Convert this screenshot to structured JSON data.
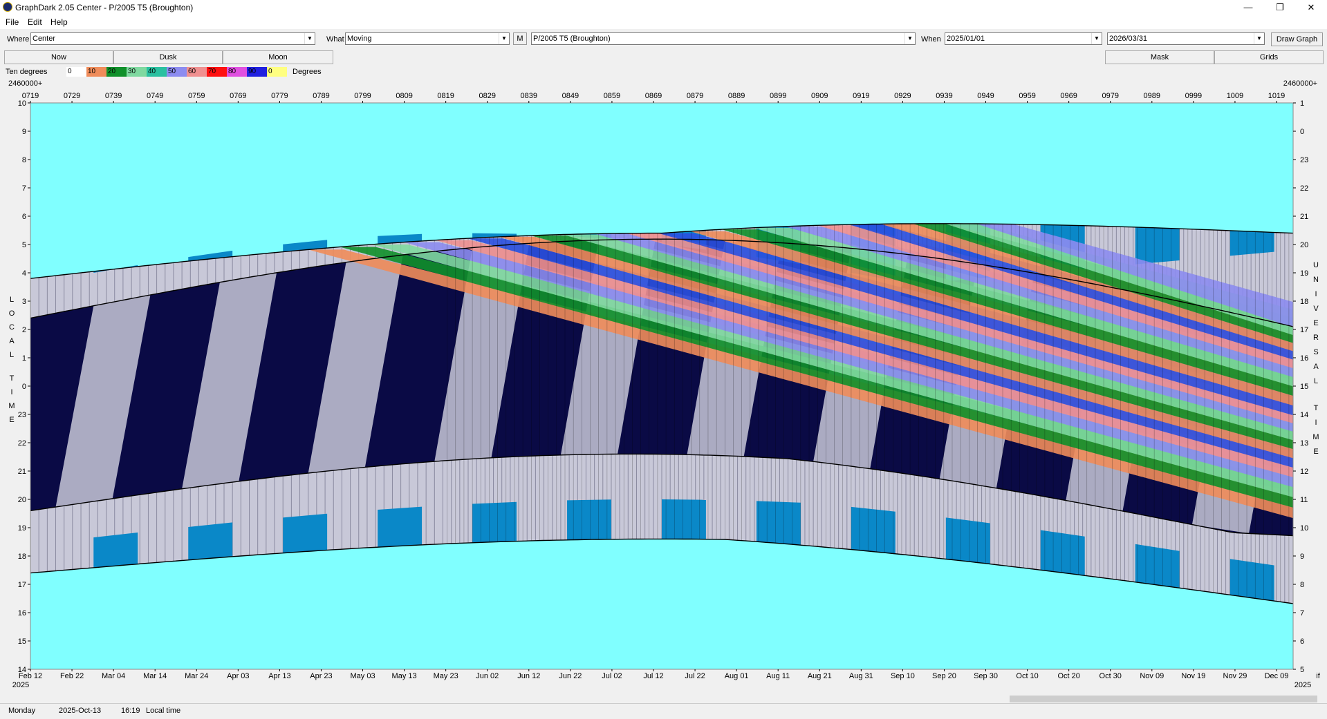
{
  "window": {
    "title": "GraphDark 2.05  Center  -  P/2005 T5 (Broughton)",
    "minimize_glyph": "—",
    "restore_glyph": "❐",
    "close_glyph": "✕"
  },
  "menu": {
    "file": "File",
    "edit": "Edit",
    "help": "Help"
  },
  "toolbar": {
    "where_label": "Where",
    "where_value": "Center",
    "what_label": "What",
    "what_value": "Moving",
    "m_button": "M",
    "object_value": "P/2005 T5 (Broughton)",
    "when_label": "When",
    "start_date": "2025/01/01",
    "end_date": "2026/03/31",
    "draw_button": "Draw Graph"
  },
  "buttons": {
    "now": "Now",
    "dusk": "Dusk",
    "moon": "Moon",
    "mask": "Mask",
    "grids": "Grids"
  },
  "legend": {
    "prefix": "Ten degrees",
    "suffix": "Degrees",
    "items": [
      {
        "label": "0",
        "color": "#ffffff"
      },
      {
        "label": "10",
        "color": "#f08c5a"
      },
      {
        "label": "20",
        "color": "#10902a"
      },
      {
        "label": "30",
        "color": "#7fd9a0"
      },
      {
        "label": "40",
        "color": "#2ac0a0"
      },
      {
        "label": "50",
        "color": "#8c8cf0"
      },
      {
        "label": "60",
        "color": "#f09090"
      },
      {
        "label": "70",
        "color": "#ff1010"
      },
      {
        "label": "80",
        "color": "#e050e0"
      },
      {
        "label": "90",
        "color": "#2020e0"
      },
      {
        "label": "0",
        "color": "#ffff80"
      }
    ]
  },
  "chart_data": {
    "type": "heatmap",
    "jd_prefix_left": "2460000+",
    "jd_prefix_right": "2460000+",
    "jd_ticks": [
      "0719",
      "0729",
      "0739",
      "0749",
      "0759",
      "0769",
      "0779",
      "0789",
      "0799",
      "0809",
      "0819",
      "0829",
      "0839",
      "0849",
      "0859",
      "0869",
      "0879",
      "0889",
      "0899",
      "0909",
      "0919",
      "0929",
      "0939",
      "0949",
      "0959",
      "0969",
      "0979",
      "0989",
      "0999",
      "1009",
      "1019"
    ],
    "date_ticks": [
      "Feb 12",
      "Feb 22",
      "Mar 04",
      "Mar 14",
      "Mar 24",
      "Apr 03",
      "Apr 13",
      "Apr 23",
      "May 03",
      "May 13",
      "May 23",
      "Jun 02",
      "Jun 12",
      "Jun 22",
      "Jul 02",
      "Jul 12",
      "Jul 22",
      "Aug 01",
      "Aug 11",
      "Aug 21",
      "Aug 31",
      "Sep 10",
      "Sep 20",
      "Sep 30",
      "Oct 10",
      "Oct 20",
      "Oct 30",
      "Nov 09",
      "Nov 19",
      "Nov 29",
      "Dec 09"
    ],
    "right_corner_label": "if",
    "year_left": "2025",
    "year_right": "2025",
    "left_axis_title": "LOCAL TIME",
    "right_axis_title": "UNIVERSAL TIME",
    "left_ticks": [
      "10",
      "9",
      "8",
      "7",
      "6",
      "5",
      "4",
      "3",
      "2",
      "1",
      "0",
      "23",
      "22",
      "21",
      "20",
      "19",
      "18",
      "17",
      "16",
      "15",
      "14"
    ],
    "right_ticks": [
      "1",
      "0",
      "23",
      "22",
      "21",
      "20",
      "19",
      "18",
      "17",
      "16",
      "15",
      "14",
      "13",
      "12",
      "11",
      "10",
      "9",
      "8",
      "7",
      "6",
      "5"
    ],
    "colors": {
      "day": "#80ffff",
      "night": "#0a0a45",
      "twilight_light": "#c8c8d8",
      "twilight_blue": "#0a88c8",
      "object_bands": [
        "#f08c5a",
        "#10902a",
        "#7fd9a0",
        "#8c8cf0",
        "#f09090",
        "#2a50e0"
      ]
    }
  },
  "status": {
    "day": "Monday",
    "date": "2025-Oct-13",
    "time": "16:19",
    "mode": "Local time"
  }
}
